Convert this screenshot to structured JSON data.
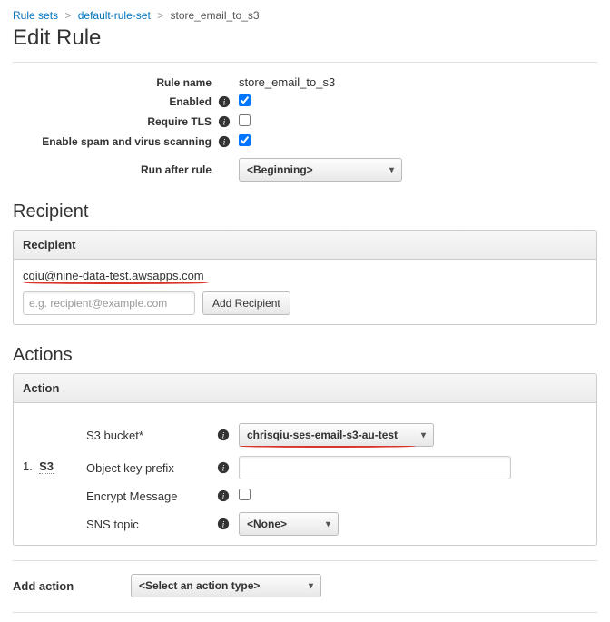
{
  "breadcrumb": {
    "root": "Rule sets",
    "mid": "default-rule-set",
    "current": "store_email_to_s3"
  },
  "page_title": "Edit Rule",
  "form": {
    "rule_name_label": "Rule name",
    "rule_name_value": "store_email_to_s3",
    "enabled_label": "Enabled",
    "enabled_checked": true,
    "require_tls_label": "Require TLS",
    "require_tls_checked": false,
    "scan_label": "Enable spam and virus scanning",
    "scan_checked": true,
    "run_after_label": "Run after rule",
    "run_after_value": "<Beginning>"
  },
  "recipient": {
    "section_title": "Recipient",
    "panel_title": "Recipient",
    "value": "cqiu@nine-data-test.awsapps.com",
    "input_placeholder": "e.g. recipient@example.com",
    "add_button": "Add Recipient"
  },
  "actions": {
    "section_title": "Actions",
    "panel_title": "Action",
    "item_number": "1.",
    "item_type": "S3",
    "s3_bucket_label": "S3 bucket*",
    "s3_bucket_value": "chrisqiu-ses-email-s3-au-test",
    "prefix_label": "Object key prefix",
    "prefix_value": "",
    "encrypt_label": "Encrypt Message",
    "encrypt_checked": false,
    "sns_label": "SNS topic",
    "sns_value": "<None>",
    "add_action_label": "Add action",
    "add_action_value": "<Select an action type>"
  }
}
